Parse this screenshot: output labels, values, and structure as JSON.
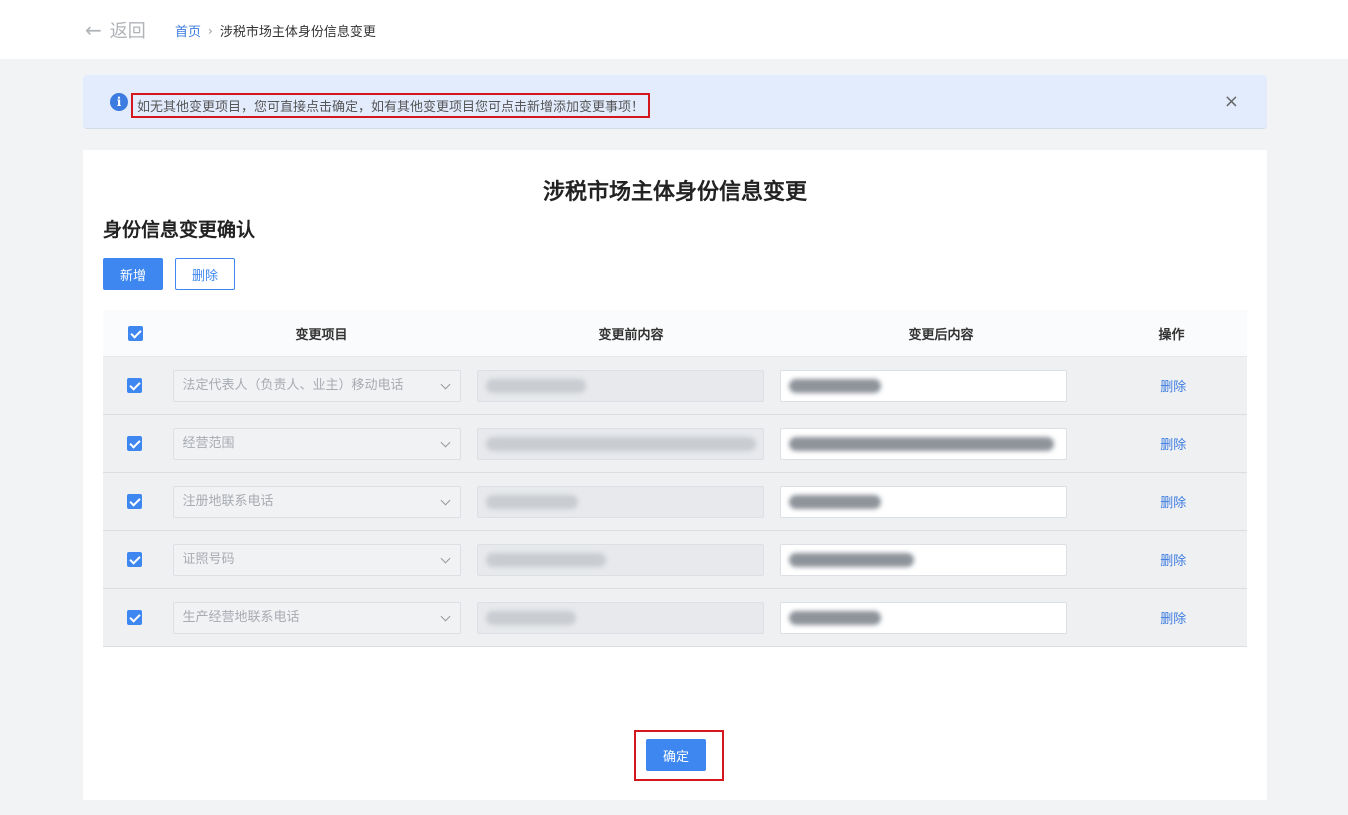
{
  "header": {
    "back_label": "返回",
    "breadcrumb_home": "首页",
    "breadcrumb_separator": "›",
    "breadcrumb_current": "涉税市场主体身份信息变更"
  },
  "notice": {
    "icon": "info-icon",
    "icon_glyph": "i",
    "text": "如无其他变更项目，您可直接点击确定，如有其他变更项目您可点击新增添加变更事项！",
    "close_glyph": "×"
  },
  "page": {
    "title": "涉税市场主体身份信息变更",
    "section_title": "身份信息变更确认"
  },
  "toolbar": {
    "add_label": "新增",
    "delete_label": "删除"
  },
  "table": {
    "headers": {
      "item": "变更项目",
      "before": "变更前内容",
      "after": "变更后内容",
      "operation": "操作"
    },
    "rows": [
      {
        "item": "法定代表人（负责人、业主）移动电话",
        "checked": true,
        "operation": "删除"
      },
      {
        "item": "经营范围",
        "checked": true,
        "operation": "删除"
      },
      {
        "item": "注册地联系电话",
        "checked": true,
        "operation": "删除"
      },
      {
        "item": "证照号码",
        "checked": true,
        "operation": "删除"
      },
      {
        "item": "生产经营地联系电话",
        "checked": true,
        "operation": "删除"
      }
    ]
  },
  "footer": {
    "confirm_label": "确定"
  },
  "colors": {
    "primary": "#3e87f0",
    "highlight_border": "#d4161d",
    "notice_bg": "#e3ecfd"
  }
}
